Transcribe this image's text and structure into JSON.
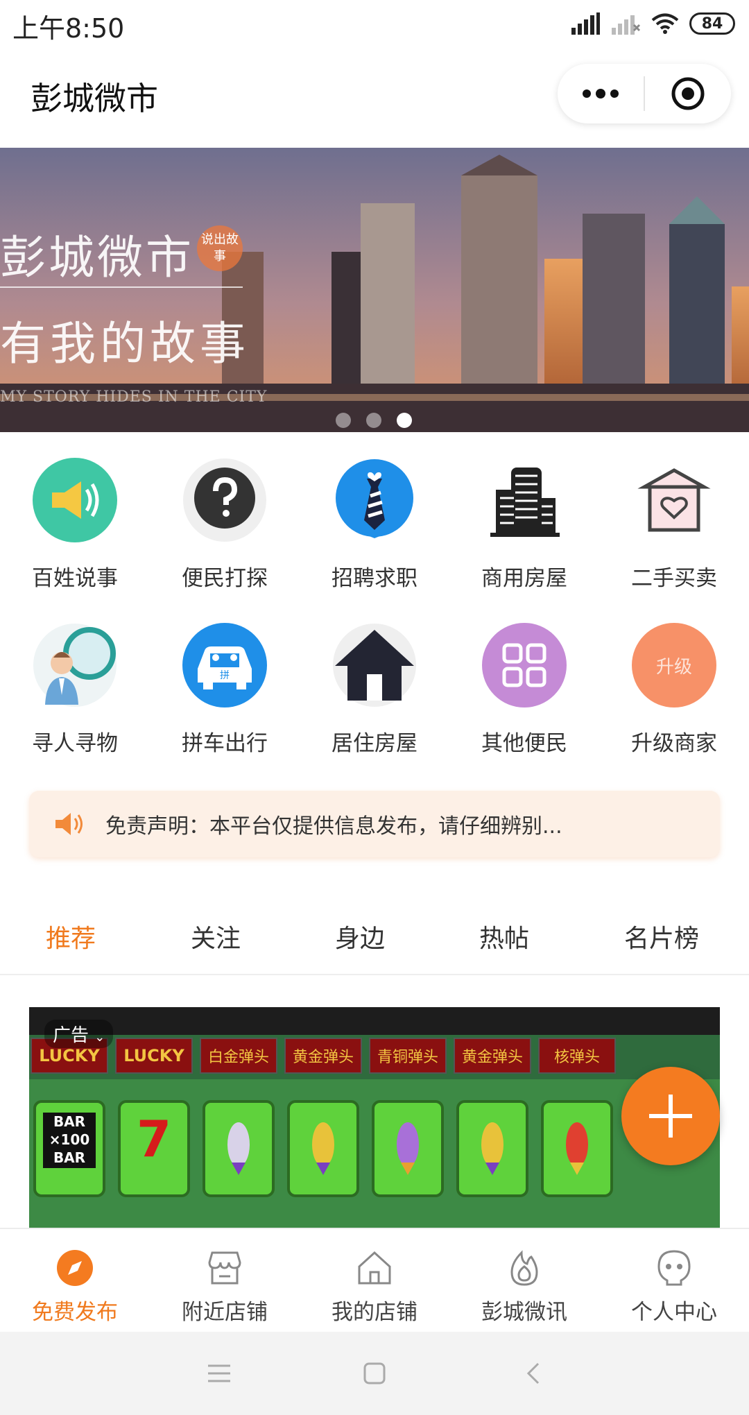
{
  "status_bar": {
    "time": "上午8:50",
    "battery": "84"
  },
  "header": {
    "title": "彭城微市"
  },
  "banner": {
    "title": "彭城微市",
    "badge": "说出故事",
    "subtitle": "有我的故事",
    "english": "MY STORY HIDES IN THE CITY",
    "active_dot": 3
  },
  "categories": [
    [
      {
        "label": "百姓说事",
        "icon": "megaphone-icon"
      },
      {
        "label": "便民打探",
        "icon": "question-icon"
      },
      {
        "label": "招聘求职",
        "icon": "tie-icon"
      },
      {
        "label": "商用房屋",
        "icon": "buildings-icon"
      },
      {
        "label": "二手买卖",
        "icon": "box-heart-icon"
      }
    ],
    [
      {
        "label": "寻人寻物",
        "icon": "magnifier-person-icon"
      },
      {
        "label": "拼车出行",
        "icon": "carpool-icon"
      },
      {
        "label": "居住房屋",
        "icon": "house-icon"
      },
      {
        "label": "其他便民",
        "icon": "grid-icon"
      },
      {
        "label": "升级商家",
        "icon": "upgrade-icon",
        "icon_text": "升级"
      }
    ]
  ],
  "notice": {
    "text": "免责声明：本平台仅提供信息发布，请仔细辨别..."
  },
  "tabs": [
    "推荐",
    "关注",
    "身边",
    "热帖",
    "名片榜"
  ],
  "active_tab": 0,
  "ad": {
    "label": "广告",
    "slot_labels": [
      "LUCKY",
      "LUCKY",
      "白金弹头",
      "黄金弹头",
      "青铜弹头",
      "黄金弹头",
      "核弹头"
    ],
    "bar_text": [
      "BAR",
      "×100",
      "BAR"
    ],
    "seven": "7"
  },
  "bottom_nav": [
    "免费发布",
    "附近店铺",
    "我的店铺",
    "彭城微讯",
    "个人中心"
  ],
  "colors": {
    "accent": "#f07a1e",
    "fab": "#f47b20",
    "notice_bg": "#fdf0e6"
  }
}
